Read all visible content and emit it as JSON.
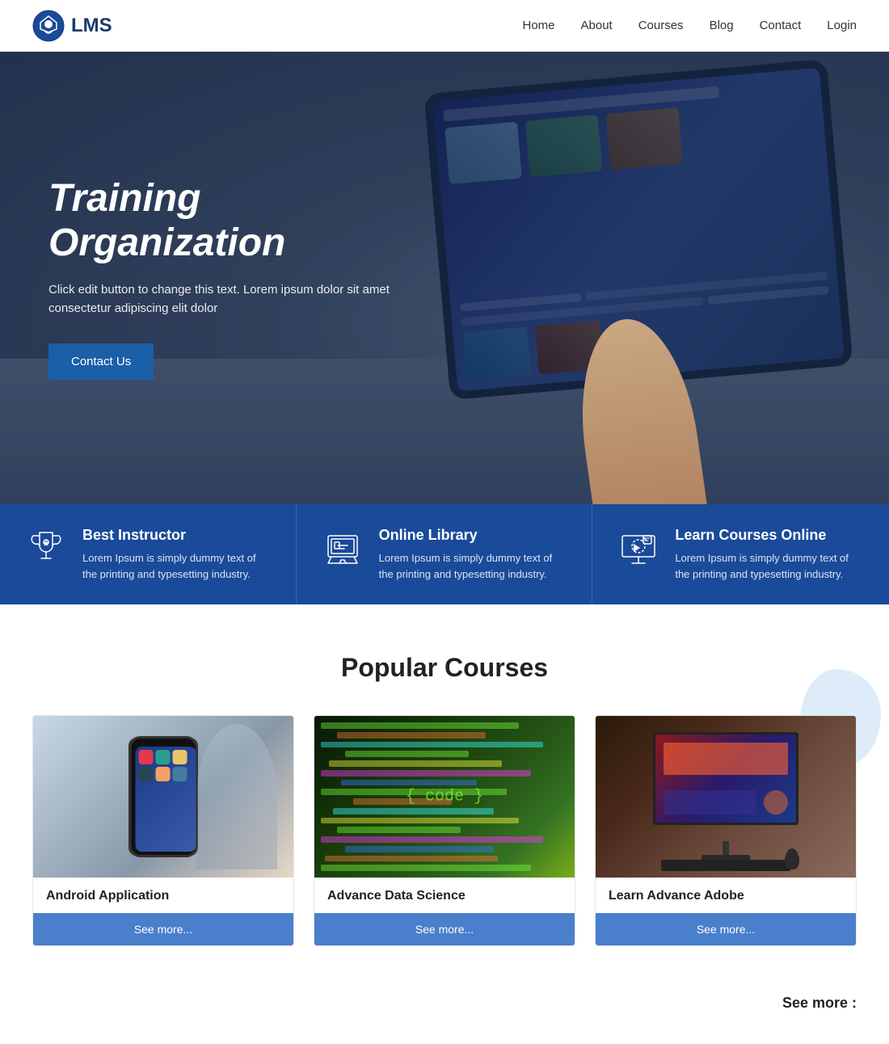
{
  "header": {
    "logo_text": "LMS",
    "nav_items": [
      {
        "label": "Home",
        "url": "#"
      },
      {
        "label": "About",
        "url": "#"
      },
      {
        "label": "Courses",
        "url": "#"
      },
      {
        "label": "Blog",
        "url": "#"
      },
      {
        "label": "Contact",
        "url": "#"
      },
      {
        "label": "Login",
        "url": "#"
      }
    ]
  },
  "hero": {
    "title": "Training Organization",
    "subtitle": "Click edit button to change this text. Lorem ipsum dolor sit amet consectetur adipiscing elit dolor",
    "cta_label": "Contact Us"
  },
  "features": [
    {
      "icon": "trophy-icon",
      "title": "Best Instructor",
      "description": "Lorem Ipsum is simply dummy text of the printing and typesetting industry."
    },
    {
      "icon": "library-icon",
      "title": "Online Library",
      "description": "Lorem Ipsum is simply dummy text of the printing and typesetting industry."
    },
    {
      "icon": "monitor-icon",
      "title": "Learn Courses Online",
      "description": "Lorem Ipsum is simply dummy text of the printing and typesetting industry."
    }
  ],
  "popular_courses": {
    "section_title": "Popular Courses",
    "courses": [
      {
        "title": "Android Application",
        "thumb_type": "android",
        "see_more_label": "See more..."
      },
      {
        "title": "Advance Data Science",
        "thumb_type": "data",
        "see_more_label": "See more..."
      },
      {
        "title": "Learn Advance Adobe",
        "thumb_type": "adobe",
        "see_more_label": "See more..."
      }
    ]
  },
  "bottom": {
    "see_more_label": "See more :"
  }
}
